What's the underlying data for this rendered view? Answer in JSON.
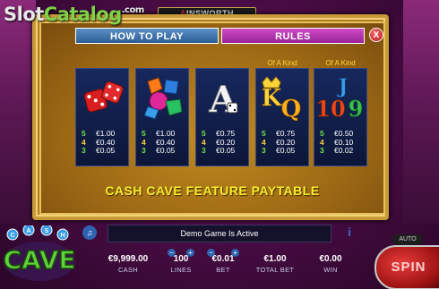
{
  "watermark": {
    "part1": "Slot",
    "part2": "Catalog",
    "dot": ".com"
  },
  "brand": {
    "mark": "A",
    "name": "INSWORTH"
  },
  "tabs": {
    "how_to_play": "HOW TO PLAY",
    "rules": "RULES",
    "close": "X"
  },
  "symbols": [
    {
      "icon": "dice-icon",
      "pays": [
        [
          "5",
          "€1.00"
        ],
        [
          "4",
          "€0.40"
        ],
        [
          "3",
          "€0.05"
        ]
      ]
    },
    {
      "icon": "gems-icon",
      "pays": [
        [
          "5",
          "€1.00"
        ],
        [
          "4",
          "€0.40"
        ],
        [
          "3",
          "€0.05"
        ]
      ]
    },
    {
      "icon": "ace-icon",
      "art_text": "A",
      "pays": [
        [
          "5",
          "€0.75"
        ],
        [
          "4",
          "€0.20"
        ],
        [
          "3",
          "€0.05"
        ]
      ]
    },
    {
      "icon": "king-queen-icon",
      "kind_label": "Of A Kind",
      "art_text": [
        "K",
        "Q"
      ],
      "pays": [
        [
          "5",
          "€0.75"
        ],
        [
          "4",
          "€0.20"
        ],
        [
          "3",
          "€0.05"
        ]
      ]
    },
    {
      "icon": "jack-ten-nine-icon",
      "kind_label": "Of A Kind",
      "art_text": [
        "J",
        "10",
        "9"
      ],
      "pays": [
        [
          "5",
          "€0.50"
        ],
        [
          "4",
          "€0.10"
        ],
        [
          "3",
          "€0.02"
        ]
      ]
    }
  ],
  "paytable_title": "CASH CAVE FEATURE PAYTABLE",
  "message": "Demo Game Is Active",
  "logo": {
    "line1": "CASH",
    "line2": "CAVE"
  },
  "stats": {
    "cash": {
      "value": "€9,999.00",
      "label": "CASH"
    },
    "lines": {
      "value": "100",
      "label": "LINES"
    },
    "bet": {
      "value": "€0.01",
      "label": "BET"
    },
    "total_bet": {
      "value": "€1.00",
      "label": "TOTAL BET"
    },
    "win": {
      "value": "€0.00",
      "label": "WIN"
    }
  },
  "buttons": {
    "auto": "AUTO",
    "spin": "SPIN",
    "minus": "−",
    "plus": "+"
  },
  "colors": {
    "tab_how": "#2d5d94",
    "tab_rules": "#9a2396",
    "title": "#f5ef2f",
    "spin": "#c41e1e"
  }
}
